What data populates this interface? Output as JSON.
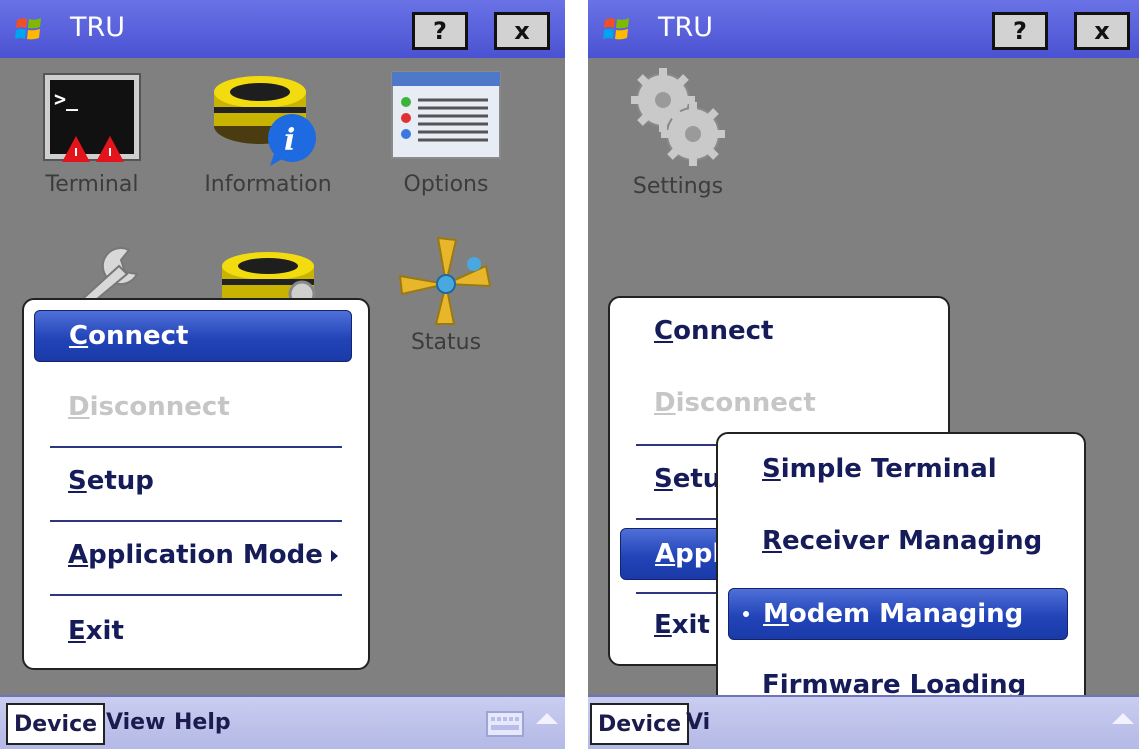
{
  "title_bar": {
    "title": "TRU",
    "help_label": "?",
    "close_label": "x"
  },
  "left": {
    "icons": [
      {
        "label": "Terminal",
        "icon": "terminal-icon"
      },
      {
        "label": "Information",
        "icon": "information-icon"
      },
      {
        "label": "Options",
        "icon": "options-icon"
      },
      {
        "label": "",
        "icon": "wrench-icon"
      },
      {
        "label": "",
        "icon": "receiver-gear-icon"
      },
      {
        "label": "Status",
        "icon": "status-icon"
      }
    ],
    "menu": {
      "items": [
        {
          "accel": "C",
          "rest": "onnect",
          "state": "highlighted"
        },
        {
          "accel": "D",
          "rest": "isconnect",
          "state": "disabled"
        },
        {
          "accel": "S",
          "rest": "etup",
          "state": "normal"
        },
        {
          "accel": "A",
          "rest": "pplication Mode",
          "state": "normal",
          "submenu": true
        },
        {
          "accel": "E",
          "rest": "xit",
          "state": "normal"
        }
      ]
    }
  },
  "right": {
    "icons": [
      {
        "label": "Settings",
        "icon": "settings-gears-icon"
      }
    ],
    "menu": {
      "items": [
        {
          "accel": "C",
          "rest": "onnect"
        },
        {
          "accel": "D",
          "rest": "isconnect",
          "state": "disabled"
        },
        {
          "accel": "S",
          "rest": "etu"
        },
        {
          "accel": "A",
          "rest": "ppl",
          "state": "highlighted"
        },
        {
          "accel": "E",
          "rest": "xit"
        }
      ]
    },
    "submenu": {
      "items": [
        {
          "accel": "S",
          "rest": "imple Terminal"
        },
        {
          "accel": "R",
          "rest": "eceiver Managing"
        },
        {
          "accel": "M",
          "rest": "odem Managing",
          "state": "selected"
        },
        {
          "accel": "F",
          "rest": "irmware Loading"
        }
      ]
    }
  },
  "menubar": {
    "left": [
      "Device",
      "View",
      "Help"
    ],
    "right": [
      "Device",
      "Vi"
    ],
    "active": "Device"
  },
  "colors": {
    "title_bar": "#5a62dc",
    "desktop": "#808080",
    "menu_highlight": "#2a4cc0",
    "menu_text": "#161c5a",
    "disabled_text": "#c6c6c6"
  }
}
